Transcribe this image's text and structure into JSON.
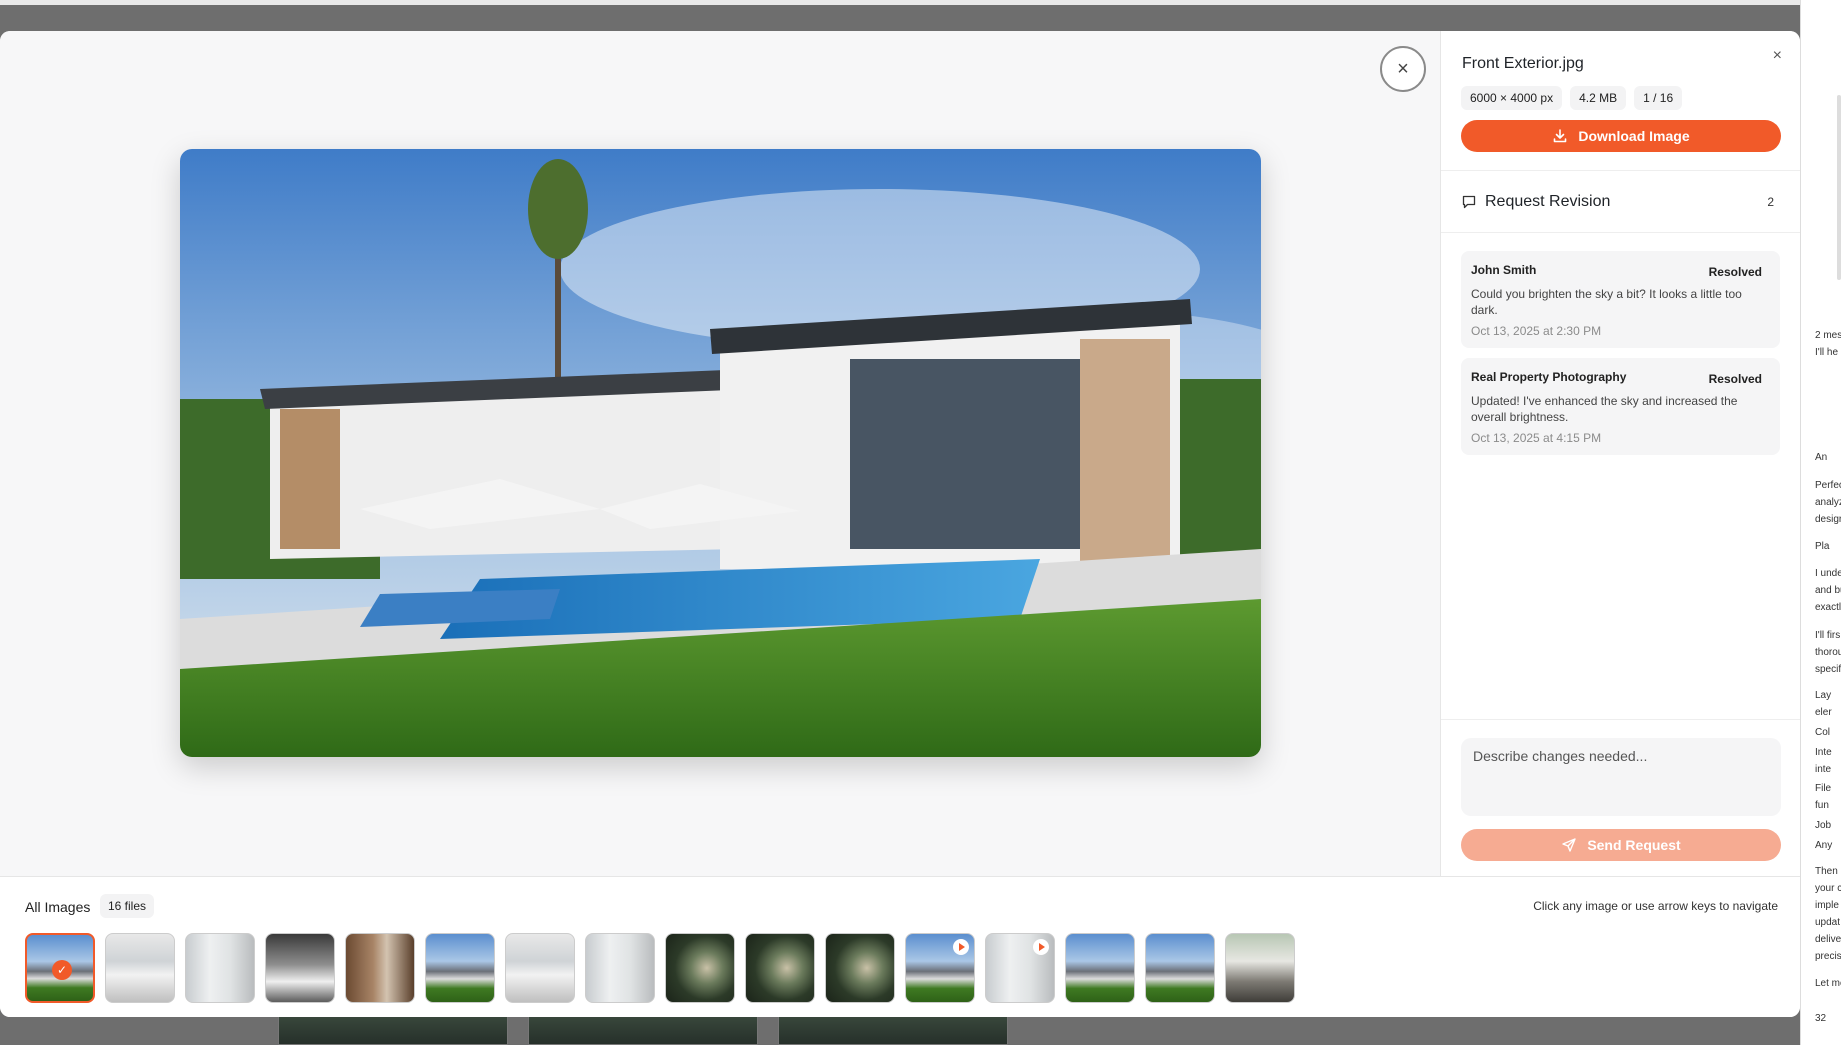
{
  "modal": {
    "close_icon": "×",
    "file_name": "Front Exterior.jpg",
    "panel_close_icon": "×",
    "meta": {
      "dimensions": "6000 × 4000 px",
      "size": "4.2 MB",
      "position": "1 / 16"
    },
    "download_label": "Download Image",
    "revision": {
      "title": "Request Revision",
      "count": "2",
      "comments": [
        {
          "author": "John Smith",
          "status": "Resolved",
          "body": "Could you brighten the sky a bit? It looks a little too dark.",
          "time": "Oct 13, 2025 at 2:30 PM"
        },
        {
          "author": "Real Property Photography",
          "status": "Resolved",
          "body": "Updated! I've enhanced the sky and increased the overall brightness.",
          "time": "Oct 13, 2025 at 4:15 PM"
        }
      ]
    },
    "compose": {
      "placeholder": "Describe changes needed...",
      "send_label": "Send Request"
    }
  },
  "gallery": {
    "label": "All Images",
    "count": "16 files",
    "hint": "Click any image or use arrow keys to navigate",
    "thumbnails": [
      {
        "kind": "exterior",
        "selected": true
      },
      {
        "kind": "bathroom"
      },
      {
        "kind": "bathroom-wide"
      },
      {
        "kind": "bathroom-dark"
      },
      {
        "kind": "bathroom-wood"
      },
      {
        "kind": "exterior"
      },
      {
        "kind": "bathroom"
      },
      {
        "kind": "bathroom-wide"
      },
      {
        "kind": "aerial"
      },
      {
        "kind": "aerial"
      },
      {
        "kind": "aerial"
      },
      {
        "kind": "exterior",
        "video": true
      },
      {
        "kind": "bathroom-wide",
        "video": true
      },
      {
        "kind": "exterior"
      },
      {
        "kind": "exterior"
      },
      {
        "kind": "living-room"
      }
    ]
  },
  "chat_strip": {
    "lines": [
      "2 mess",
      "I'll he",
      "An",
      "Perfec",
      "analyz",
      "desigr",
      "Pla",
      "I unde",
      "and bu",
      "exactl",
      "I'll firs",
      "thorou",
      "specif",
      "Lay",
      "eler",
      "Col",
      "Inte",
      "inte",
      "File",
      "fun",
      "Job",
      "Any",
      "Then I",
      "your c",
      "imple",
      "updat",
      "delive",
      "precis",
      "Let me",
      "32"
    ]
  },
  "colors": {
    "accent": "#f15a29",
    "accent_disabled": "#f6ab92"
  }
}
